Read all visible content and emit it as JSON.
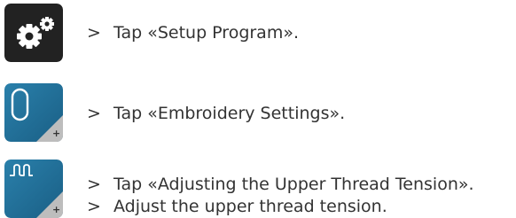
{
  "colors": {
    "setup_bg": "#222222",
    "embroidery_bg": "#1f6d96",
    "tension_bg": "#1f6d96",
    "corner_gray": "#bdbdbd",
    "text": "#333333"
  },
  "buttons": [
    {
      "name": "setup-program",
      "icon": "gear-icon"
    },
    {
      "name": "embroidery-settings",
      "icon": "hoop-icon"
    },
    {
      "name": "upper-thread-tension",
      "icon": "tension-wave-icon"
    }
  ],
  "steps": [
    {
      "arrow": ">",
      "text": "Tap «Setup Program»."
    },
    {
      "arrow": ">",
      "text": "Tap «Embroidery Settings»."
    },
    {
      "arrow": ">",
      "text": "Tap «Adjusting the Upper Thread Tension»."
    },
    {
      "arrow": ">",
      "text": "Adjust the upper thread tension."
    }
  ]
}
